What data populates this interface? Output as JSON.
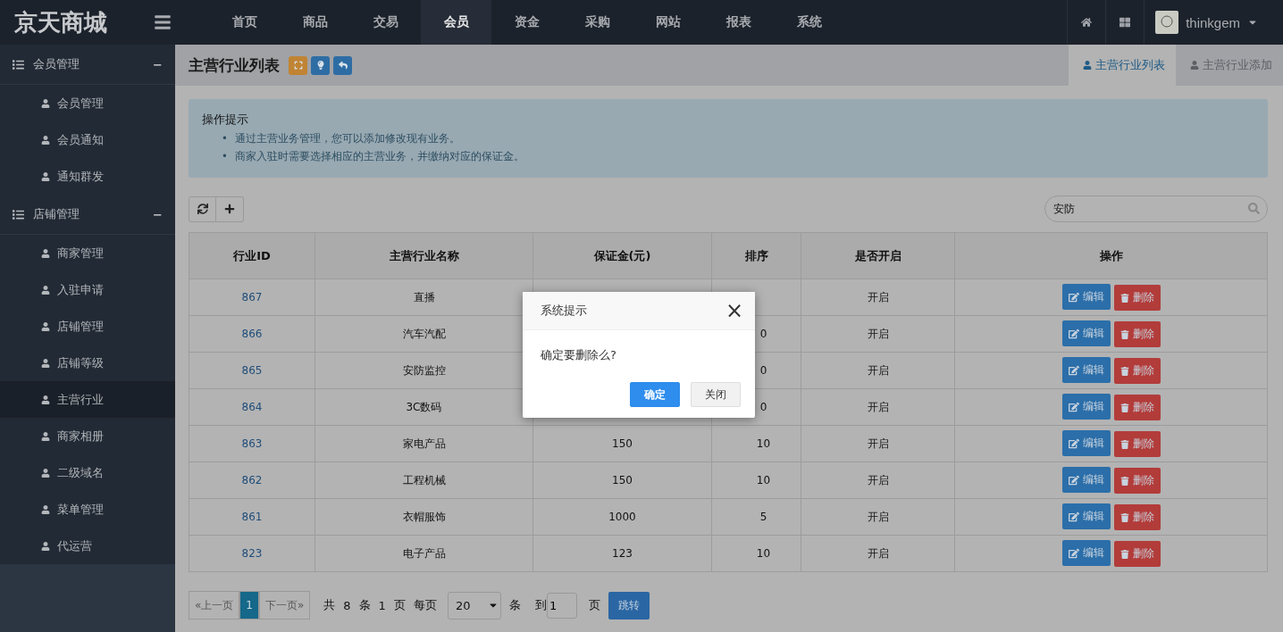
{
  "logo": "京天商城",
  "nav": [
    {
      "label": "首页",
      "selected": false
    },
    {
      "label": "商品",
      "selected": false
    },
    {
      "label": "交易",
      "selected": false
    },
    {
      "label": "会员",
      "selected": true
    },
    {
      "label": "资金",
      "selected": false
    },
    {
      "label": "采购",
      "selected": false
    },
    {
      "label": "网站",
      "selected": false
    },
    {
      "label": "报表",
      "selected": false
    },
    {
      "label": "系统",
      "selected": false
    }
  ],
  "user": {
    "name": "thinkgem"
  },
  "sidebar": [
    {
      "label": "会员管理",
      "toggle": "−",
      "children": [
        {
          "label": "会员管理",
          "selected": false
        },
        {
          "label": "会员通知",
          "selected": false
        },
        {
          "label": "通知群发",
          "selected": false
        }
      ]
    },
    {
      "label": "店铺管理",
      "toggle": "−",
      "children": [
        {
          "label": "商家管理",
          "selected": false
        },
        {
          "label": "入驻申请",
          "selected": false
        },
        {
          "label": "店铺管理",
          "selected": false
        },
        {
          "label": "店铺等级",
          "selected": false
        },
        {
          "label": "主营行业",
          "selected": true
        },
        {
          "label": "商家相册",
          "selected": false
        },
        {
          "label": "二级域名",
          "selected": false
        },
        {
          "label": "菜单管理",
          "selected": false
        },
        {
          "label": "代运营",
          "selected": false
        }
      ]
    }
  ],
  "page": {
    "title": "主营行业列表",
    "tabs": [
      {
        "label": "主营行业列表",
        "selected": true
      },
      {
        "label": "主营行业添加",
        "selected": false
      }
    ]
  },
  "tips": {
    "title": "操作提示",
    "items": [
      {
        "marker": "•",
        "text": "通过主营业务管理，您可以添加修改现有业务。"
      },
      {
        "marker": "•",
        "text": "商家入驻时需要选择相应的主营业务，并缴纳对应的保证金。"
      }
    ]
  },
  "search": {
    "value": "安防"
  },
  "table": {
    "columns": [
      "行业ID",
      "主营行业名称",
      "保证金(元)",
      "排序",
      "是否开启",
      "操作"
    ],
    "rows": [
      {
        "id": "867",
        "name": "直播",
        "status": "开启",
        "edit": "编辑",
        "delete": "删除"
      },
      {
        "id": "866",
        "name": "汽车汽配",
        "sort": "0",
        "status": "开启",
        "edit": "编辑",
        "delete": "删除"
      },
      {
        "id": "865",
        "name": "安防监控",
        "sort": "0",
        "status": "开启",
        "edit": "编辑",
        "delete": "删除"
      },
      {
        "id": "864",
        "name": "3C数码",
        "sort": "0",
        "status": "开启",
        "edit": "编辑",
        "delete": "删除"
      },
      {
        "id": "863",
        "name": "家电产品",
        "deposit": "150",
        "sort": "10",
        "status": "开启",
        "edit": "编辑",
        "delete": "删除"
      },
      {
        "id": "862",
        "name": "工程机械",
        "deposit": "150",
        "sort": "10",
        "status": "开启",
        "edit": "编辑",
        "delete": "删除"
      },
      {
        "id": "861",
        "name": "衣帽服饰",
        "deposit": "1000",
        "sort": "5",
        "status": "开启",
        "edit": "编辑",
        "delete": "删除"
      },
      {
        "id": "823",
        "name": "电子产品",
        "deposit": "123",
        "sort": "10",
        "status": "开启",
        "edit": "编辑",
        "delete": "删除"
      }
    ]
  },
  "pagination": {
    "prev": "«上一页",
    "pages": [
      {
        "label": "1",
        "selected": true
      }
    ],
    "next": "下一页»",
    "summary": [
      "共",
      "8",
      "条",
      "1",
      "页",
      "每页"
    ],
    "page_size": "20",
    "unit": "条",
    "goto": "到",
    "goto_value": "1",
    "page_unit": "页",
    "jump": "跳转"
  },
  "dialog": {
    "title": "系统提示",
    "close": "×",
    "message": "确定要删除么?",
    "confirm": "确定",
    "cancel": "关闭"
  }
}
